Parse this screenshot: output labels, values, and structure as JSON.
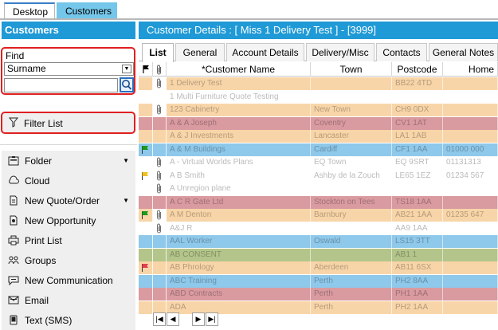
{
  "top_tabs": [
    {
      "label": "Desktop"
    },
    {
      "label": "Customers"
    }
  ],
  "sidebar": {
    "title": "Customers",
    "find_label": "Find",
    "find_field": "Surname",
    "search_value": "",
    "filter_label": "Filter List",
    "items": [
      {
        "label": "Folder",
        "icon": "folder-icon",
        "has_menu": true
      },
      {
        "label": "Cloud",
        "icon": "cloud-icon",
        "has_menu": false
      },
      {
        "label": "New Quote/Order",
        "icon": "document-icon",
        "has_menu": true
      },
      {
        "label": "New Opportunity",
        "icon": "opportunity-icon",
        "has_menu": false
      },
      {
        "label": "Print List",
        "icon": "printer-icon",
        "has_menu": false
      },
      {
        "label": "Groups",
        "icon": "groups-icon",
        "has_menu": false
      },
      {
        "label": "New Communication",
        "icon": "chat-icon",
        "has_menu": false
      },
      {
        "label": "Email",
        "icon": "email-icon",
        "has_menu": false
      },
      {
        "label": "Text (SMS)",
        "icon": "phone-icon",
        "has_menu": false
      }
    ]
  },
  "main": {
    "header": "Customer Details : [ Miss 1 Delivery Test ]  -  [3999]",
    "tabs": [
      {
        "label": "List",
        "active": true
      },
      {
        "label": "General",
        "active": false
      },
      {
        "label": "Account Details",
        "active": false
      },
      {
        "label": "Delivery/Misc",
        "active": false
      },
      {
        "label": "Contacts",
        "active": false
      },
      {
        "label": "General Notes",
        "active": false
      }
    ],
    "columns": [
      "*Customer Name",
      "Town",
      "Postcode",
      "Home"
    ],
    "rows": [
      {
        "color": "#f8d5a8",
        "flag": "",
        "clip": true,
        "name": "1 Delivery Test",
        "town": "",
        "postcode": "BB22 4TD",
        "home": ""
      },
      {
        "color": "#ffffff",
        "flag": "",
        "clip": false,
        "name": "1 Multi Furniture Quote Testing",
        "town": "",
        "postcode": "",
        "home": ""
      },
      {
        "color": "#f8d5a8",
        "flag": "",
        "clip": true,
        "name": "123 Cabinetry",
        "town": "New Town",
        "postcode": "CH9 0DX",
        "home": ""
      },
      {
        "color": "#d99aa0",
        "flag": "",
        "clip": false,
        "name": "A & A Joseph",
        "town": "Coventry",
        "postcode": "CV1 1AT",
        "home": ""
      },
      {
        "color": "#f8d5a8",
        "flag": "",
        "clip": false,
        "name": "A & J Investments",
        "town": "Lancaster",
        "postcode": "LA1 1AB",
        "home": ""
      },
      {
        "color": "#8ec8ea",
        "flag": "green",
        "clip": false,
        "name": "A & M Buildings",
        "town": "Cardiff",
        "postcode": "CF1 1AA",
        "home": "01000 000"
      },
      {
        "color": "#ffffff",
        "flag": "",
        "clip": true,
        "name": "A - Virtual Worlds Plans",
        "town": "EQ Town",
        "postcode": "EQ 9SRT",
        "home": "01131313"
      },
      {
        "color": "#ffffff",
        "flag": "yellow",
        "clip": true,
        "name": "A B Smith",
        "town": "Ashby de la Zouch",
        "postcode": "LE65 1EZ",
        "home": "01234 567"
      },
      {
        "color": "#ffffff",
        "flag": "",
        "clip": true,
        "name": "A Unregion plane",
        "town": "",
        "postcode": "",
        "home": ""
      },
      {
        "color": "#d99aa0",
        "flag": "",
        "clip": false,
        "name": "A C R Gate Ltd",
        "town": "Stockton on Tees",
        "postcode": "TS18 1AA",
        "home": ""
      },
      {
        "color": "#f8d5a8",
        "flag": "green",
        "clip": true,
        "name": "A M Denton",
        "town": "Barnbury",
        "postcode": "AB21 1AA",
        "home": "01235 647"
      },
      {
        "color": "#ffffff",
        "flag": "",
        "clip": true,
        "name": "A&J R",
        "town": "",
        "postcode": "AA9 1AA",
        "home": ""
      },
      {
        "color": "#8ec8ea",
        "flag": "",
        "clip": false,
        "name": "AAL Worker",
        "town": "Oswald",
        "postcode": "LS15 3TT",
        "home": ""
      },
      {
        "color": "#b3c58a",
        "flag": "",
        "clip": false,
        "name": "AB CONSENT",
        "town": "",
        "postcode": "AB1 1",
        "home": ""
      },
      {
        "color": "#f8d5a8",
        "flag": "red",
        "clip": false,
        "name": "AB Phrology",
        "town": "Aberdeen",
        "postcode": "AB11 6SX",
        "home": ""
      },
      {
        "color": "#8ec8ea",
        "flag": "",
        "clip": false,
        "name": "ABC Training",
        "town": "Perth",
        "postcode": "PH2 8AA",
        "home": ""
      },
      {
        "color": "#d99aa0",
        "flag": "",
        "clip": false,
        "name": "ABD Contracts",
        "town": "Perth",
        "postcode": "PH1 1AA",
        "home": ""
      },
      {
        "color": "#f8d5a8",
        "flag": "",
        "clip": false,
        "name": "ADA",
        "town": "Perth",
        "postcode": "PH2 1AA",
        "home": ""
      }
    ],
    "pager": [
      "first",
      "prev",
      "next",
      "last"
    ]
  }
}
